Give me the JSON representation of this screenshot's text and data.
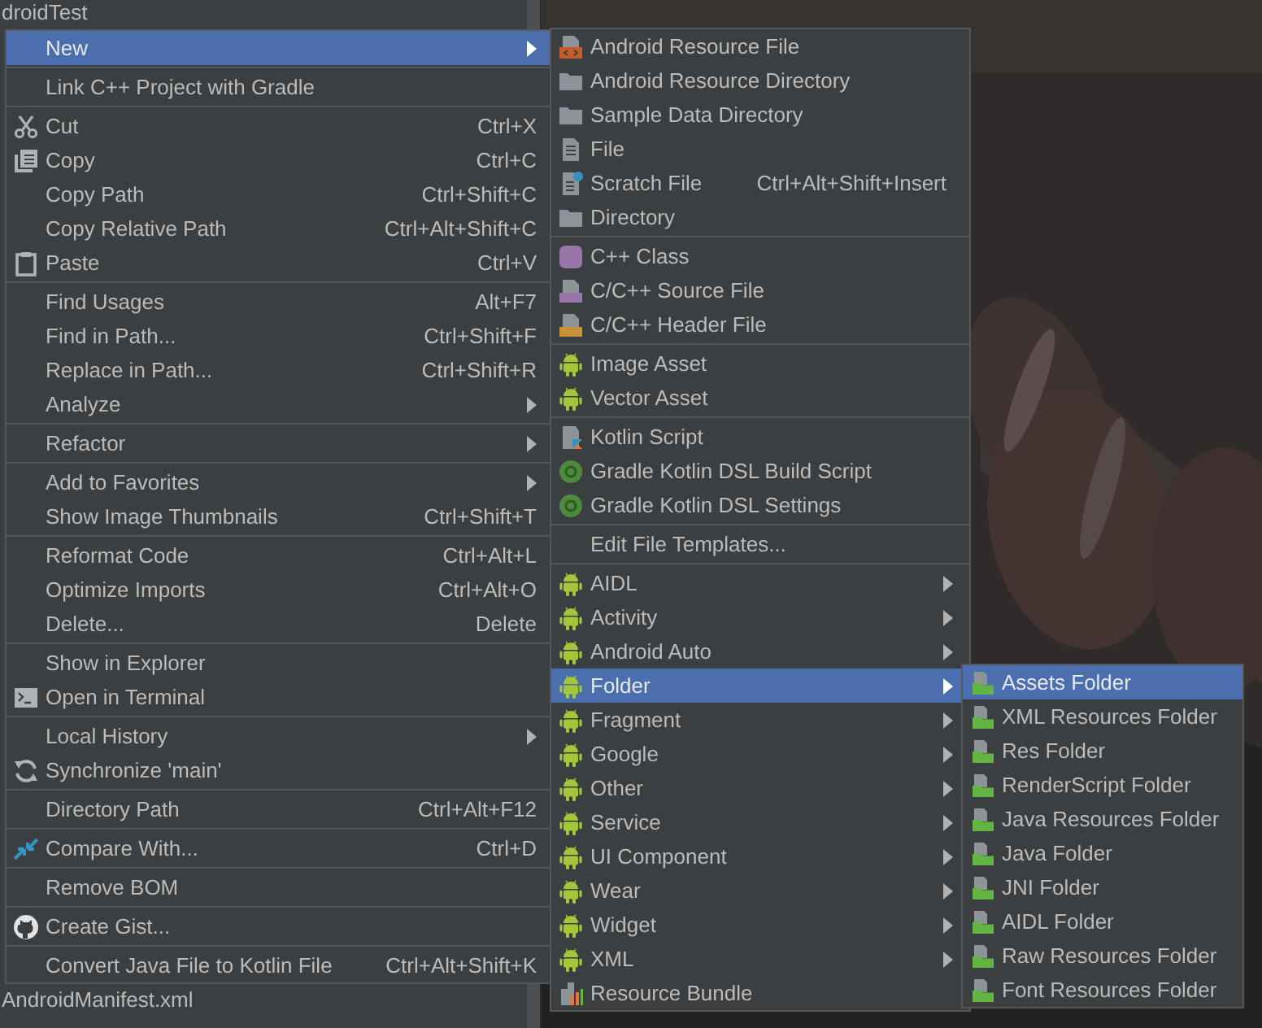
{
  "project_panel": {
    "items": [
      {
        "label": "droidTest"
      },
      {
        "label": "AndroidManifest.xml"
      }
    ]
  },
  "context_menu": {
    "groups": [
      [
        {
          "label": "New",
          "submenu": true,
          "selected": true
        }
      ],
      [
        {
          "label": "Link C++ Project with Gradle",
          "submenu": false,
          "selected": false
        }
      ],
      [
        {
          "label": "Cut",
          "shortcut": "Ctrl+X",
          "submenu": false,
          "selected": false
        },
        {
          "label": "Copy",
          "shortcut": "Ctrl+C",
          "submenu": false,
          "selected": false
        },
        {
          "label": "Copy Path",
          "shortcut": "Ctrl+Shift+C",
          "submenu": false,
          "selected": false
        },
        {
          "label": "Copy Relative Path",
          "shortcut": "Ctrl+Alt+Shift+C",
          "submenu": false,
          "selected": false
        },
        {
          "label": "Paste",
          "shortcut": "Ctrl+V",
          "submenu": false,
          "selected": false
        }
      ],
      [
        {
          "label": "Find Usages",
          "shortcut": "Alt+F7",
          "submenu": false,
          "selected": false
        },
        {
          "label": "Find in Path...",
          "shortcut": "Ctrl+Shift+F",
          "submenu": false,
          "selected": false
        },
        {
          "label": "Replace in Path...",
          "shortcut": "Ctrl+Shift+R",
          "submenu": false,
          "selected": false
        },
        {
          "label": "Analyze",
          "submenu": true,
          "selected": false
        }
      ],
      [
        {
          "label": "Refactor",
          "submenu": true,
          "selected": false
        }
      ],
      [
        {
          "label": "Add to Favorites",
          "submenu": true,
          "selected": false
        },
        {
          "label": "Show Image Thumbnails",
          "shortcut": "Ctrl+Shift+T",
          "submenu": false,
          "selected": false
        }
      ],
      [
        {
          "label": "Reformat Code",
          "shortcut": "Ctrl+Alt+L",
          "submenu": false,
          "selected": false
        },
        {
          "label": "Optimize Imports",
          "shortcut": "Ctrl+Alt+O",
          "submenu": false,
          "selected": false
        },
        {
          "label": "Delete...",
          "shortcut": "Delete",
          "submenu": false,
          "selected": false
        }
      ],
      [
        {
          "label": "Show in Explorer",
          "submenu": false,
          "selected": false
        },
        {
          "label": "Open in Terminal",
          "submenu": false,
          "selected": false
        }
      ],
      [
        {
          "label": "Local History",
          "submenu": true,
          "selected": false
        },
        {
          "label": "Synchronize 'main'",
          "submenu": false,
          "selected": false
        }
      ],
      [
        {
          "label": "Directory Path",
          "shortcut": "Ctrl+Alt+F12",
          "submenu": false,
          "selected": false
        }
      ],
      [
        {
          "label": "Compare With...",
          "shortcut": "Ctrl+D",
          "submenu": false,
          "selected": false
        }
      ],
      [
        {
          "label": "Remove BOM",
          "submenu": false,
          "selected": false
        }
      ],
      [
        {
          "label": "Create Gist...",
          "submenu": false,
          "selected": false
        }
      ],
      [
        {
          "label": "Convert Java File to Kotlin File",
          "shortcut": "Ctrl+Alt+Shift+K",
          "submenu": false,
          "selected": false
        }
      ]
    ]
  },
  "new_submenu": {
    "groups": [
      [
        {
          "label": "Android Resource File",
          "submenu": false,
          "selected": false
        },
        {
          "label": "Android Resource Directory",
          "submenu": false,
          "selected": false
        },
        {
          "label": "Sample Data Directory",
          "submenu": false,
          "selected": false
        },
        {
          "label": "File",
          "submenu": false,
          "selected": false
        },
        {
          "label": "Scratch File",
          "shortcut": "Ctrl+Alt+Shift+Insert",
          "submenu": false,
          "selected": false
        },
        {
          "label": "Directory",
          "submenu": false,
          "selected": false
        }
      ],
      [
        {
          "label": "C++ Class",
          "submenu": false,
          "selected": false
        },
        {
          "label": "C/C++ Source File",
          "submenu": false,
          "selected": false
        },
        {
          "label": "C/C++ Header File",
          "submenu": false,
          "selected": false
        }
      ],
      [
        {
          "label": "Image Asset",
          "submenu": false,
          "selected": false
        },
        {
          "label": "Vector Asset",
          "submenu": false,
          "selected": false
        }
      ],
      [
        {
          "label": "Kotlin Script",
          "submenu": false,
          "selected": false
        },
        {
          "label": "Gradle Kotlin DSL Build Script",
          "submenu": false,
          "selected": false
        },
        {
          "label": "Gradle Kotlin DSL Settings",
          "submenu": false,
          "selected": false
        }
      ],
      [
        {
          "label": "Edit File Templates...",
          "submenu": false,
          "selected": false
        }
      ],
      [
        {
          "label": "AIDL",
          "submenu": true,
          "selected": false
        },
        {
          "label": "Activity",
          "submenu": true,
          "selected": false
        },
        {
          "label": "Android Auto",
          "submenu": true,
          "selected": false
        },
        {
          "label": "Folder",
          "submenu": true,
          "selected": true
        },
        {
          "label": "Fragment",
          "submenu": true,
          "selected": false
        },
        {
          "label": "Google",
          "submenu": true,
          "selected": false
        },
        {
          "label": "Other",
          "submenu": true,
          "selected": false
        },
        {
          "label": "Service",
          "submenu": true,
          "selected": false
        },
        {
          "label": "UI Component",
          "submenu": true,
          "selected": false
        },
        {
          "label": "Wear",
          "submenu": true,
          "selected": false
        },
        {
          "label": "Widget",
          "submenu": true,
          "selected": false
        },
        {
          "label": "XML",
          "submenu": true,
          "selected": false
        },
        {
          "label": "Resource Bundle",
          "submenu": false,
          "selected": false
        }
      ]
    ]
  },
  "folder_submenu": {
    "groups": [
      [
        {
          "label": "Assets Folder",
          "submenu": false,
          "selected": true
        },
        {
          "label": "XML Resources Folder",
          "submenu": false,
          "selected": false
        },
        {
          "label": "Res Folder",
          "submenu": false,
          "selected": false
        },
        {
          "label": "RenderScript Folder",
          "submenu": false,
          "selected": false
        },
        {
          "label": "Java Resources Folder",
          "submenu": false,
          "selected": false
        },
        {
          "label": "Java Folder",
          "submenu": false,
          "selected": false
        },
        {
          "label": "JNI Folder",
          "submenu": false,
          "selected": false
        },
        {
          "label": "AIDL Folder",
          "submenu": false,
          "selected": false
        },
        {
          "label": "Raw Resources Folder",
          "submenu": false,
          "selected": false
        },
        {
          "label": "Font Resources Folder",
          "submenu": false,
          "selected": false
        }
      ]
    ]
  }
}
